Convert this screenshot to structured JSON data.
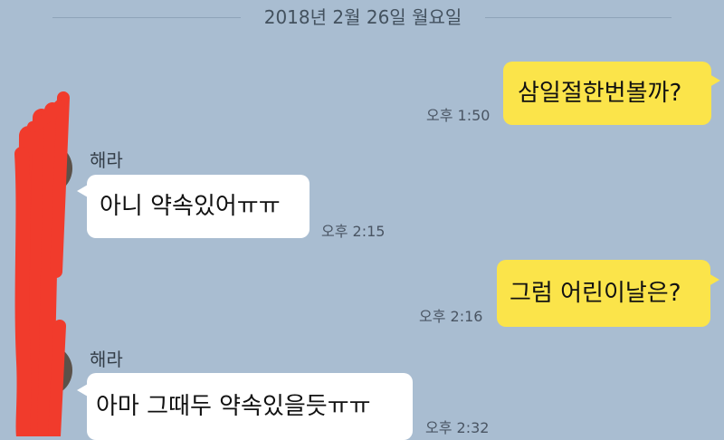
{
  "chat": {
    "date": "2018년 2월 26일 월요일",
    "messages": [
      {
        "id": "m1",
        "from": "me",
        "text": "삼일절한번볼까?",
        "time": "오후 1:50"
      },
      {
        "id": "m2",
        "from": "other",
        "sender": "해라",
        "text": "아니 약속있어ㅠㅠ",
        "time": "오후 2:15"
      },
      {
        "id": "m3",
        "from": "me",
        "text": "그럼 어린이날은?",
        "time": "오후 2:16"
      },
      {
        "id": "m4",
        "from": "other",
        "sender": "해라",
        "text": "아마 그때두 약속있을듯ㅠㅠ",
        "time": "오후 2:32"
      }
    ]
  },
  "colors": {
    "background": "#a9bdd1",
    "my_bubble": "#fbe44a",
    "their_bubble": "#ffffff",
    "redaction_scribble": "#f13b2c"
  },
  "icons": [
    "avatar-photo",
    "red-redaction-scribble"
  ]
}
